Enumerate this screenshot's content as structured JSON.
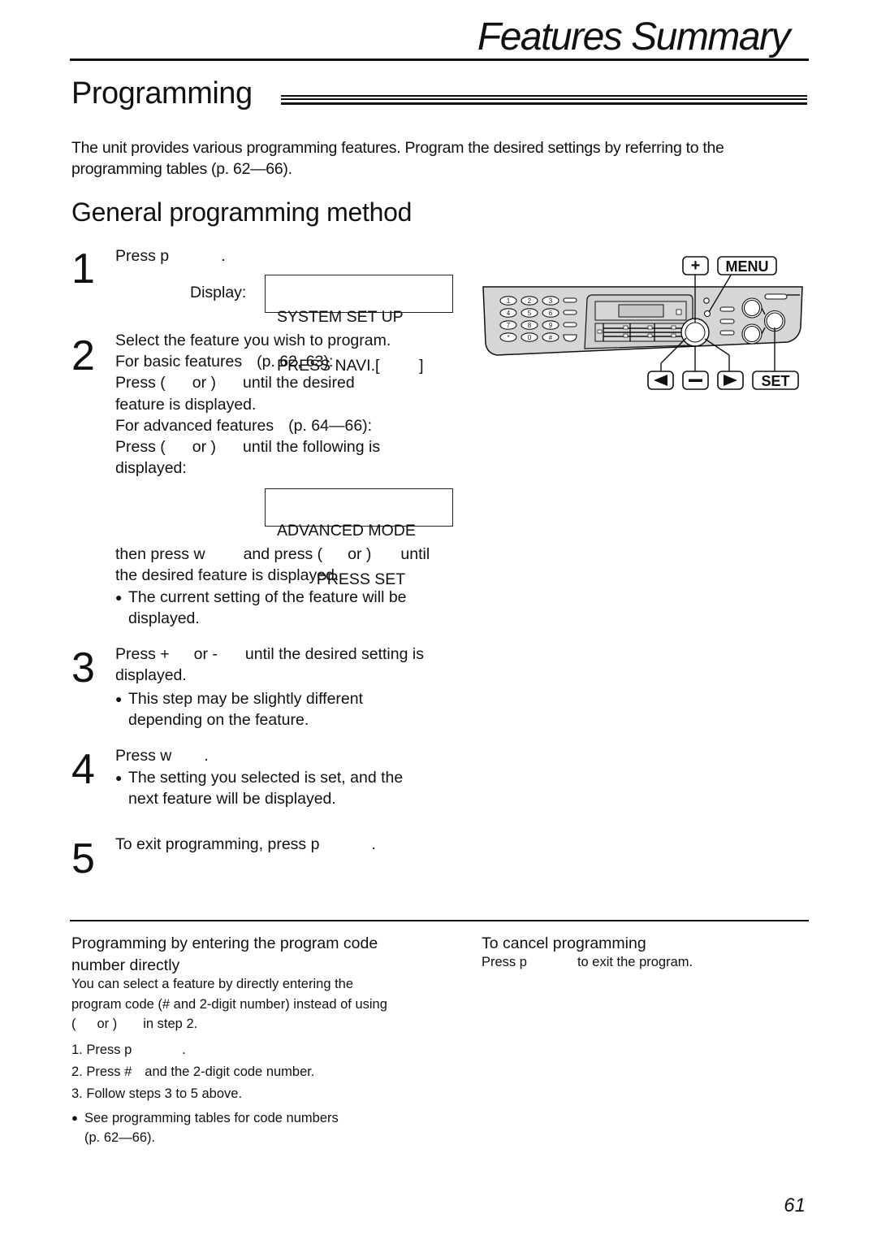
{
  "header": {
    "chapter_title": "Features Summary"
  },
  "section": {
    "title": "Programming",
    "intro_line1": "The unit provides various programming features. Program the desired settings by referring to the",
    "intro_line2": "programming tables (p. 62—66)."
  },
  "method": {
    "title": "General programming method",
    "steps": [
      {
        "number": "1",
        "line1_a": "Press p",
        "line1_b": ".",
        "display_label": "Display:",
        "lcd_line1": "SYSTEM SET UP",
        "lcd_line2": "PRESS NAVI.[         ]"
      },
      {
        "number": "2",
        "line1": "Select the feature you wish to program.",
        "line2_a": "For basic features",
        "line2_b": "(p. 62, 63):",
        "line3_a": "Press (",
        "line3_b": "or )",
        "line3_c": "until the desired",
        "line4": "feature is displayed.",
        "line5_a": "For advanced features",
        "line5_b": "(p. 64—66):",
        "line6_a": "Press (",
        "line6_b": "or )",
        "line6_c": "until the following is",
        "line7": "displayed:",
        "lcd_line1": "ADVANCED MODE",
        "lcd_line2": "         PRESS SET",
        "line8_a": "then press w",
        "line8_b": "and press (",
        "line8_c": "or )",
        "line8_d": "until",
        "line9": "the desired feature is displayed.",
        "bullet_line1": "The current setting of the feature will be",
        "bullet_line2": "displayed."
      },
      {
        "number": "3",
        "line1_a": "Press +",
        "line1_b": "or -",
        "line1_c": "until the desired setting is",
        "line2": "displayed.",
        "bullet_line1": "This step may be slightly different",
        "bullet_line2": "depending on the feature."
      },
      {
        "number": "4",
        "line1_a": "Press w",
        "line1_b": ".",
        "bullet_line1": "The setting you selected is set, and the",
        "bullet_line2": "next feature will be displayed."
      },
      {
        "number": "5",
        "line1_a": "To exit programming, press p",
        "line1_b": "."
      }
    ]
  },
  "panel_illustration": {
    "keypad": [
      "1",
      "2",
      "3",
      "4",
      "5",
      "6",
      "7",
      "8",
      "9",
      "*",
      "0",
      "#"
    ],
    "callouts": {
      "plus": "+",
      "menu": "MENU",
      "left": "◀",
      "minus": "−",
      "right": "▶",
      "set": "SET"
    }
  },
  "tips": {
    "direct": {
      "title_line1": "Programming by entering the program code",
      "title_line2": "number directly",
      "body_line1": "You can select a feature by directly entering the",
      "body_line2": "program code (# and 2-digit number) instead of using",
      "body_line3_a": "(",
      "body_line3_b": "or )",
      "body_line3_c": "in step 2.",
      "list": [
        {
          "num": "1.",
          "text_a": "Press p",
          "text_b": "."
        },
        {
          "num": "2.",
          "text_a": "Press #",
          "text_b": "and the 2-digit code number."
        },
        {
          "num": "3.",
          "text_a": "Follow steps 3 to 5 above.",
          "text_b": ""
        }
      ],
      "bullet_line1": "See programming tables for code numbers",
      "bullet_line2": "(p. 62—66)."
    },
    "cancel": {
      "title": "To cancel programming",
      "body_a": "Press p",
      "body_b": "to exit the program."
    }
  },
  "footer": {
    "page_number": "61"
  }
}
